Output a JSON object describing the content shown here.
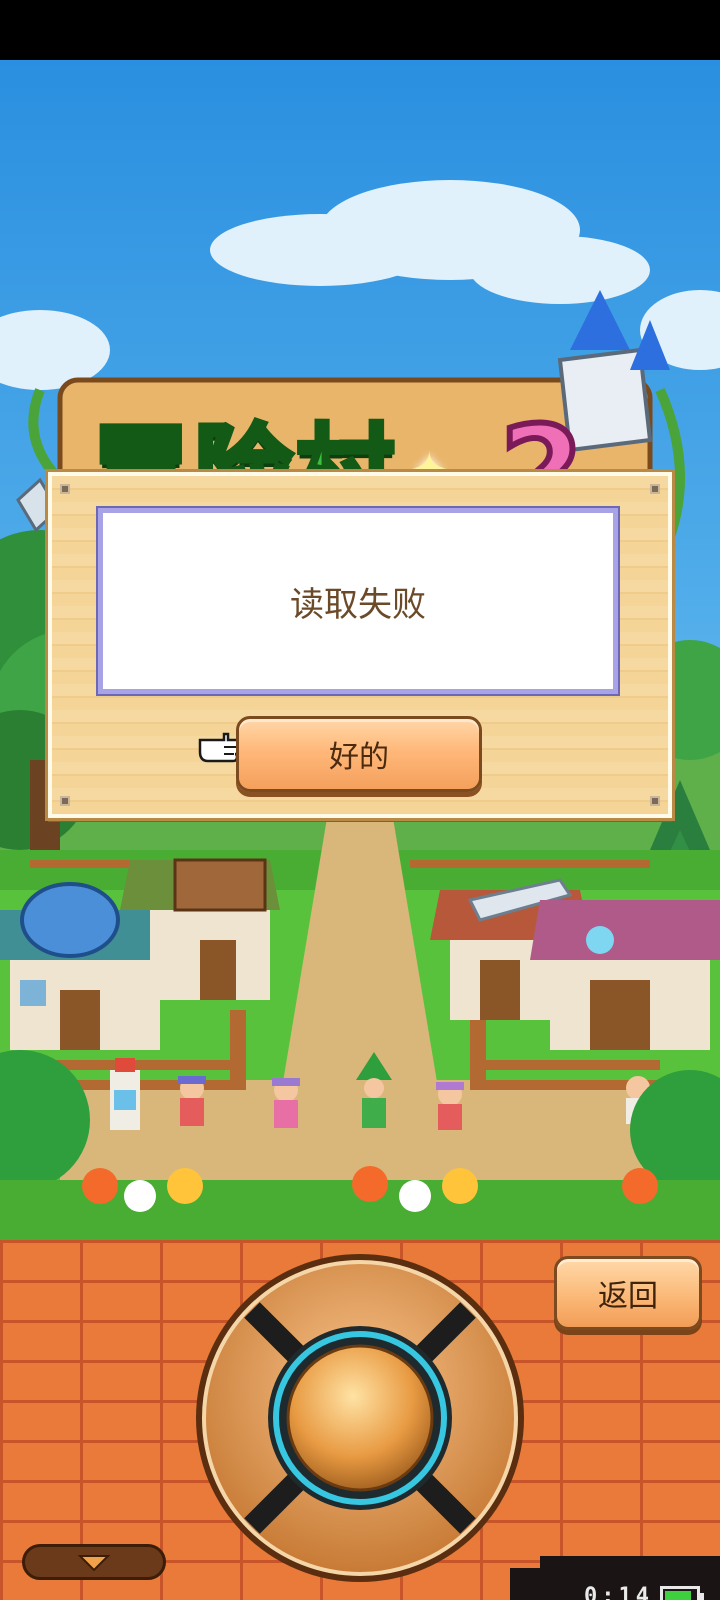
{
  "game": {
    "logo_title": "冒险村",
    "logo_number": "2"
  },
  "dialog": {
    "message": "读取失败",
    "ok_label": "好的"
  },
  "controls": {
    "back_label": "返回",
    "clock": "0:14",
    "battery_level": 0.85
  },
  "icons": {
    "pointer": "pointing-hand-icon",
    "menu": "chevron-down-icon",
    "dpad": "directional-pad"
  },
  "colors": {
    "sky": "#3aa3e8",
    "button": "#fbb978",
    "brick": "#e97a3a",
    "logo_green": "#3cc23c",
    "dialog_border": "#a8a2e6"
  }
}
